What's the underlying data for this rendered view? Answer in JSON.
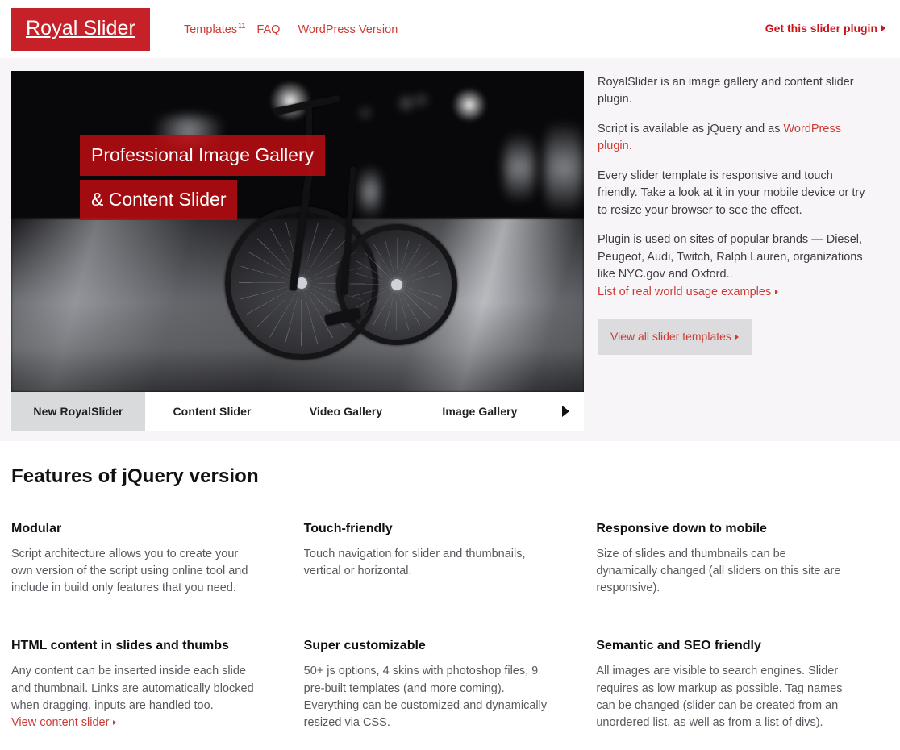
{
  "header": {
    "logo_text": "Royal Slider",
    "nav": [
      {
        "label": "Templates",
        "sup": "11"
      },
      {
        "label": "FAQ",
        "sup": ""
      },
      {
        "label": "WordPress Version",
        "sup": ""
      }
    ],
    "cta_label": "Get this slider plugin"
  },
  "hero": {
    "slide": {
      "caption_line1": "Professional Image Gallery",
      "caption_line2": "& Content Slider"
    },
    "tabs": [
      {
        "label": "New RoyalSlider",
        "active": true
      },
      {
        "label": "Content Slider",
        "active": false
      },
      {
        "label": "Video Gallery",
        "active": false
      },
      {
        "label": "Image Gallery",
        "active": false
      }
    ],
    "tabs_next_icon": "triangle-right-icon",
    "side": {
      "p1": "RoyalSlider is an image gallery and content slider plugin.",
      "p2_before": "Script is available as jQuery and as ",
      "p2_link": "WordPress plugin.",
      "p3": "Every slider template is responsive and touch friendly. Take a look at it in your mobile device or try to resize your browser to see the effect.",
      "p4": "Plugin is used on sites of popular brands — Diesel, Peugeot, Audi, Twitch, Ralph Lauren, organizations like NYC.gov and Oxford..",
      "p4_link": "List of real world usage examples",
      "button_label": "View all slider templates"
    }
  },
  "features": {
    "title": "Features of jQuery version",
    "items": [
      {
        "title": "Modular",
        "body": "Script architecture allows you to create your own version of the script using online tool and include in build only features that you need.",
        "link": ""
      },
      {
        "title": "Touch-friendly",
        "body": "Touch navigation for slider and thumbnails, vertical or horizontal.",
        "link": ""
      },
      {
        "title": "Responsive down to mobile",
        "body": "Size of slides and thumbnails can be dynamically changed (all sliders on this site are responsive).",
        "link": ""
      },
      {
        "title": "HTML content in slides and thumbs",
        "body": "Any content can be inserted inside each slide and thumbnail. Links are automatically blocked when dragging, inputs are handled too.",
        "link": "View content slider"
      },
      {
        "title": "Super customizable",
        "body": "50+ js options, 4 skins with photoshop files, 9 pre-built templates (and more coming). Everything can be customized and dynamically resized via CSS.",
        "link": ""
      },
      {
        "title": "Semantic and SEO friendly",
        "body": "All images are visible to search engines. Slider requires as low markup as possible. Tag names can be changed (slider can be created from an unordered list, as well as from a list of divs).",
        "link": ""
      }
    ]
  },
  "colors": {
    "brand_red": "#c62128",
    "link_red": "#cd3b35",
    "cta_red": "#c8151b",
    "caption_bg": "#b70d12",
    "hero_bg": "#f7f5f8",
    "active_tab_bg": "#d9dadc",
    "body_text": "#58585e"
  }
}
